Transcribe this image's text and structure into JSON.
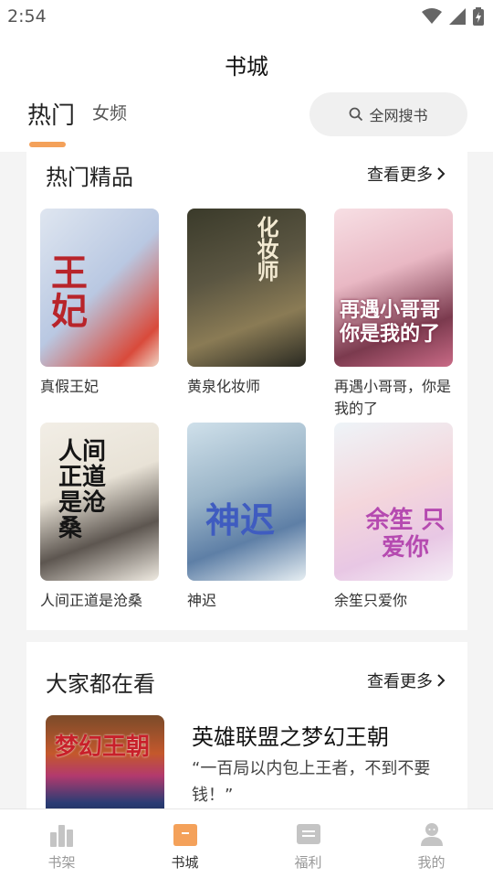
{
  "status_bar": {
    "time": "2:54"
  },
  "header": {
    "title": "书城",
    "tabs": [
      {
        "label": "热门",
        "active": true
      },
      {
        "label": "女频",
        "active": false
      }
    ],
    "search_label": "全网搜书"
  },
  "hot_section": {
    "title": "热门精品",
    "more_label": "查看更多",
    "books": [
      {
        "name": "真假王妃",
        "cover_text": "王妃"
      },
      {
        "name": "黄泉化妆师",
        "cover_text": "化妆师"
      },
      {
        "name": "再遇小哥哥，你是我的了",
        "cover_text": "再遇小哥哥 你是我的了"
      },
      {
        "name": "人间正道是沧桑",
        "cover_text": "人间正道是沧桑"
      },
      {
        "name": "神迟",
        "cover_text": "神迟"
      },
      {
        "name": "余笙只爱你",
        "cover_text": "余笙 只爱你"
      }
    ]
  },
  "popular_section": {
    "title": "大家都在看",
    "more_label": "查看更多",
    "featured": {
      "name": "英雄联盟之梦幻王朝",
      "description": "“一百局以内包上王者，不到不要钱！”",
      "cover_text": "梦幻王朝"
    }
  },
  "bottom_nav": [
    {
      "label": "书架",
      "active": false
    },
    {
      "label": "书城",
      "active": true
    },
    {
      "label": "福利",
      "active": false
    },
    {
      "label": "我的",
      "active": false
    }
  ],
  "colors": {
    "accent": "#f4a15a",
    "background": "#f4f4f4",
    "inactive": "#bbbbbb"
  }
}
